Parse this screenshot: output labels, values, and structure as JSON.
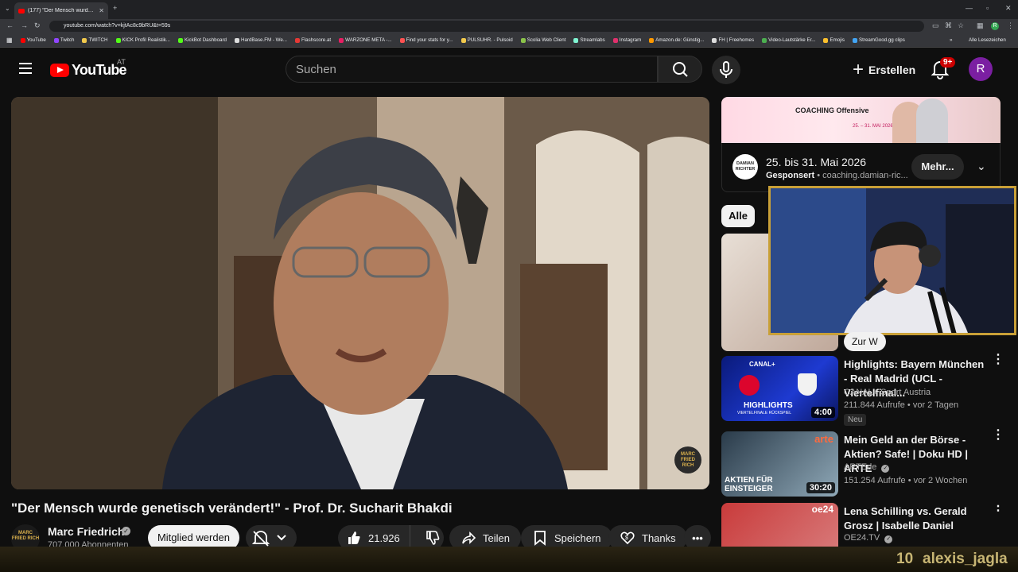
{
  "browser": {
    "tab_title": "(177) \"Der Mensch wurde gene",
    "url": "youtube.com/watch?v=kjtAc8c9bRU&t=59s",
    "profile_initial": "R",
    "bookmarks": [
      {
        "label": "YouTube",
        "color": "#ff0000"
      },
      {
        "label": "Twitch",
        "color": "#9146ff"
      },
      {
        "label": "TWITCH",
        "color": "#f2c94c"
      },
      {
        "label": "KICK Profil Realistik...",
        "color": "#53fc18"
      },
      {
        "label": "KickBot Dashboard",
        "color": "#53fc18"
      },
      {
        "label": "HardBase.FM - We...",
        "color": "#dddddd"
      },
      {
        "label": "Flashscore.at",
        "color": "#e53935"
      },
      {
        "label": "WARZONE META -...",
        "color": "#e91e63"
      },
      {
        "label": "Find your stats for y...",
        "color": "#ff5252"
      },
      {
        "label": "PULSUHR. - Pulsoid",
        "color": "#f2c94c"
      },
      {
        "label": "Scolia Web Client",
        "color": "#8bc34a"
      },
      {
        "label": "Streamlabs",
        "color": "#80f5d2"
      },
      {
        "label": "Instagram",
        "color": "#e1306c"
      },
      {
        "label": "Amazon.de: Günstig...",
        "color": "#ff9900"
      },
      {
        "label": "FH | Freehomes",
        "color": "#dddddd"
      },
      {
        "label": "Video-Lautstärke Er...",
        "color": "#4caf50"
      },
      {
        "label": "Emojis",
        "color": "#fbc02d"
      },
      {
        "label": "StreamGood.gg clips",
        "color": "#42a5f5"
      }
    ],
    "all_bookmarks": "Alle Lesezeichen"
  },
  "header": {
    "logo": "YouTube",
    "region": "AT",
    "search_placeholder": "Suchen",
    "create_label": "Erstellen",
    "notification_badge": "9+",
    "avatar_initial": "R"
  },
  "video": {
    "title": "\"Der Mensch wurde genetisch verändert!\" - Prof. Dr. Sucharit Bhakdi",
    "watermark": "MARC FRIED RICH"
  },
  "channel": {
    "name": "Marc Friedrich",
    "subscribers": "707.000 Abonnenten",
    "avatar_text": "MARC FRIED RICH",
    "join_label": "Mitglied werden"
  },
  "actions": {
    "likes": "21.926",
    "share": "Teilen",
    "save": "Speichern",
    "thanks": "Thanks"
  },
  "ad": {
    "banner_text": "COACHING Offensive",
    "banner_dates": "25. – 31. MAI 2026",
    "title": "25. bis 31. Mai 2026",
    "sponsored": "Gesponsert",
    "domain": "coaching.damian-ric...",
    "logo_text": "DAMIAN RICHTER",
    "more_label": "Mehr..."
  },
  "chips": {
    "all": "Alle"
  },
  "recommendations": [
    {
      "title": "Highlights: Bayern München - Real Madrid (UCL - Viertelfinal...",
      "channel": "CANAL+ Sport Austria",
      "meta": "211.844 Aufrufe • vor 2 Tagen",
      "duration": "4:00",
      "badge": "Neu",
      "thumb_label": "HIGHLIGHTS",
      "thumb_sub": "VIERTELFINALE RÜCKSPIEL",
      "thumb_brand": "CANAL+"
    },
    {
      "title": "Mein Geld an der Börse - Aktien? Safe! | Doku HD | ARTE",
      "channel": "ARTEde",
      "meta": "151.254 Aufrufe • vor 2 Wochen",
      "duration": "30:20",
      "thumb_label": "AKTIEN FÜR EINSTEIGER",
      "thumb_brand": "arte"
    },
    {
      "title": "Lena Schilling vs. Gerald Grosz | Isabelle Daniel",
      "channel": "OE24.TV",
      "thumb_brand": "oe24"
    }
  ],
  "overlay": {
    "webcam_tag": "Zur W",
    "level": "10",
    "username": "alexis_jagla"
  }
}
